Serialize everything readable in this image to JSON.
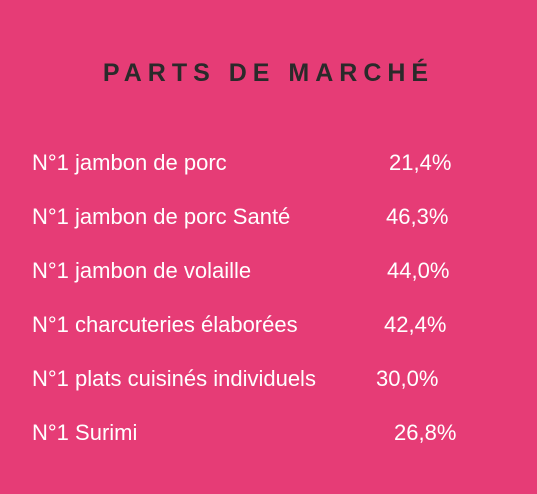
{
  "title": "PARTS DE MARCHÉ",
  "rows": [
    {
      "label": "N°1 jambon de porc",
      "value": "21,4%"
    },
    {
      "label": "N°1 jambon de porc Santé",
      "value": "46,3%"
    },
    {
      "label": "N°1 jambon de volaille",
      "value": "44,0%"
    },
    {
      "label": "N°1 charcuteries élaborées",
      "value": "42,4%"
    },
    {
      "label": "N°1 plats cuisinés individuels",
      "value": "30,0%"
    },
    {
      "label": "N°1 Surimi",
      "value": "26,8%"
    }
  ],
  "colors": {
    "background": "#e63c76",
    "title": "#2a2a2a",
    "text": "#ffffff"
  }
}
